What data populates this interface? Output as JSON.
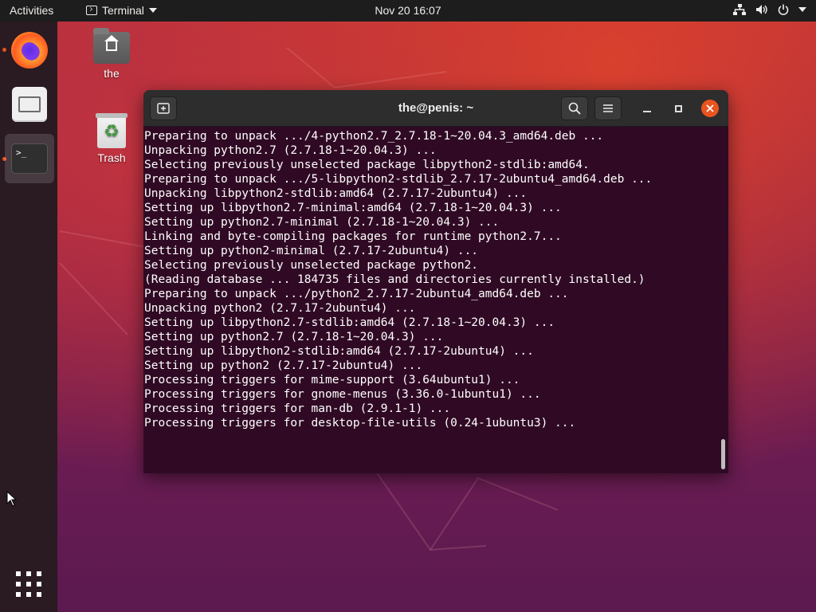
{
  "topbar": {
    "activities": "Activities",
    "app_name": "Terminal",
    "clock": "Nov 20  16:07",
    "icons": [
      "network-icon",
      "volume-icon",
      "power-icon",
      "chevron-down-icon"
    ]
  },
  "dock": {
    "items": [
      {
        "name": "firefox",
        "icon": "firefox-icon",
        "running": true
      },
      {
        "name": "files",
        "icon": "files-icon",
        "running": false
      },
      {
        "name": "terminal",
        "icon": "terminal-icon",
        "running": true,
        "active": true
      }
    ],
    "apps_icon": "show-applications-icon"
  },
  "desktop": {
    "home_label": "the",
    "trash_label": "Trash"
  },
  "window": {
    "title": "the@penis: ~",
    "lines": [
      "Preparing to unpack .../4-python2.7_2.7.18-1~20.04.3_amd64.deb ...",
      "Unpacking python2.7 (2.7.18-1~20.04.3) ...",
      "Selecting previously unselected package libpython2-stdlib:amd64.",
      "Preparing to unpack .../5-libpython2-stdlib_2.7.17-2ubuntu4_amd64.deb ...",
      "Unpacking libpython2-stdlib:amd64 (2.7.17-2ubuntu4) ...",
      "Setting up libpython2.7-minimal:amd64 (2.7.18-1~20.04.3) ...",
      "Setting up python2.7-minimal (2.7.18-1~20.04.3) ...",
      "Linking and byte-compiling packages for runtime python2.7...",
      "Setting up python2-minimal (2.7.17-2ubuntu4) ...",
      "Selecting previously unselected package python2.",
      "(Reading database ... 184735 files and directories currently installed.)",
      "Preparing to unpack .../python2_2.7.17-2ubuntu4_amd64.deb ...",
      "Unpacking python2 (2.7.17-2ubuntu4) ...",
      "Setting up libpython2.7-stdlib:amd64 (2.7.18-1~20.04.3) ...",
      "Setting up python2.7 (2.7.18-1~20.04.3) ...",
      "Setting up libpython2-stdlib:amd64 (2.7.17-2ubuntu4) ...",
      "Setting up python2 (2.7.17-2ubuntu4) ...",
      "Processing triggers for mime-support (3.64ubuntu1) ...",
      "Processing triggers for gnome-menus (3.36.0-1ubuntu1) ...",
      "Processing triggers for man-db (2.9.1-1) ...",
      "Processing triggers for desktop-file-utils (0.24-1ubuntu3) ..."
    ]
  },
  "colors": {
    "accent": "#e95420",
    "terminal_bg": "#300a24",
    "headerbar_bg": "#2d2d2d",
    "topbar_bg": "#1d1d1d"
  }
}
